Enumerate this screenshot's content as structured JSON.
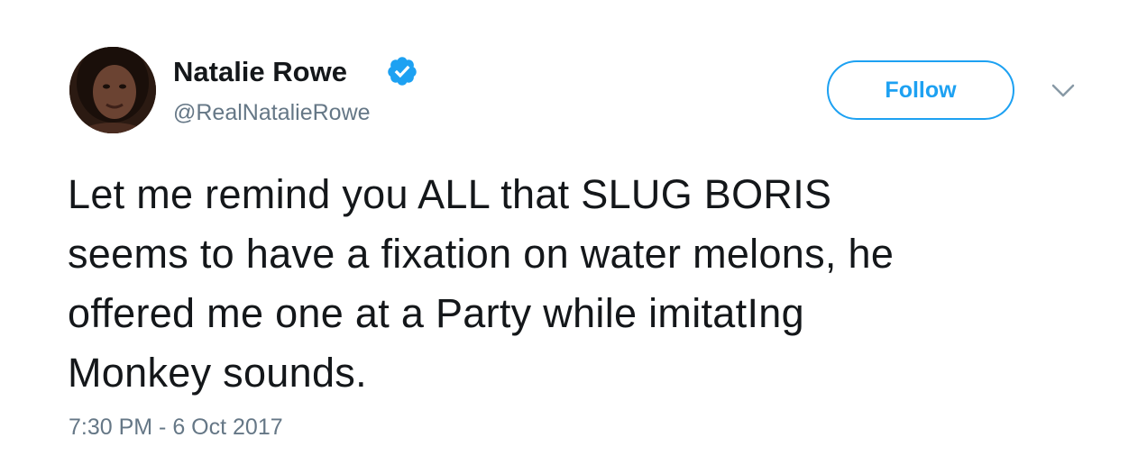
{
  "user": {
    "display_name": "Natalie Rowe",
    "handle": "@RealNatalieRowe",
    "verified": true,
    "avatar_icon": "profile-photo"
  },
  "actions": {
    "follow_label": "Follow",
    "menu_icon": "chevron-down-icon"
  },
  "tweet": {
    "lines": [
      "Let me remind you ALL that SLUG BORIS",
      "seems to have a fixation on water melons, he",
      "offered me one at a Party while imitatIng",
      "Monkey sounds."
    ],
    "timestamp": "7:30 PM - 6 Oct 2017"
  },
  "colors": {
    "accent": "#1da1f2",
    "text": "#14171a",
    "secondary": "#657786"
  }
}
